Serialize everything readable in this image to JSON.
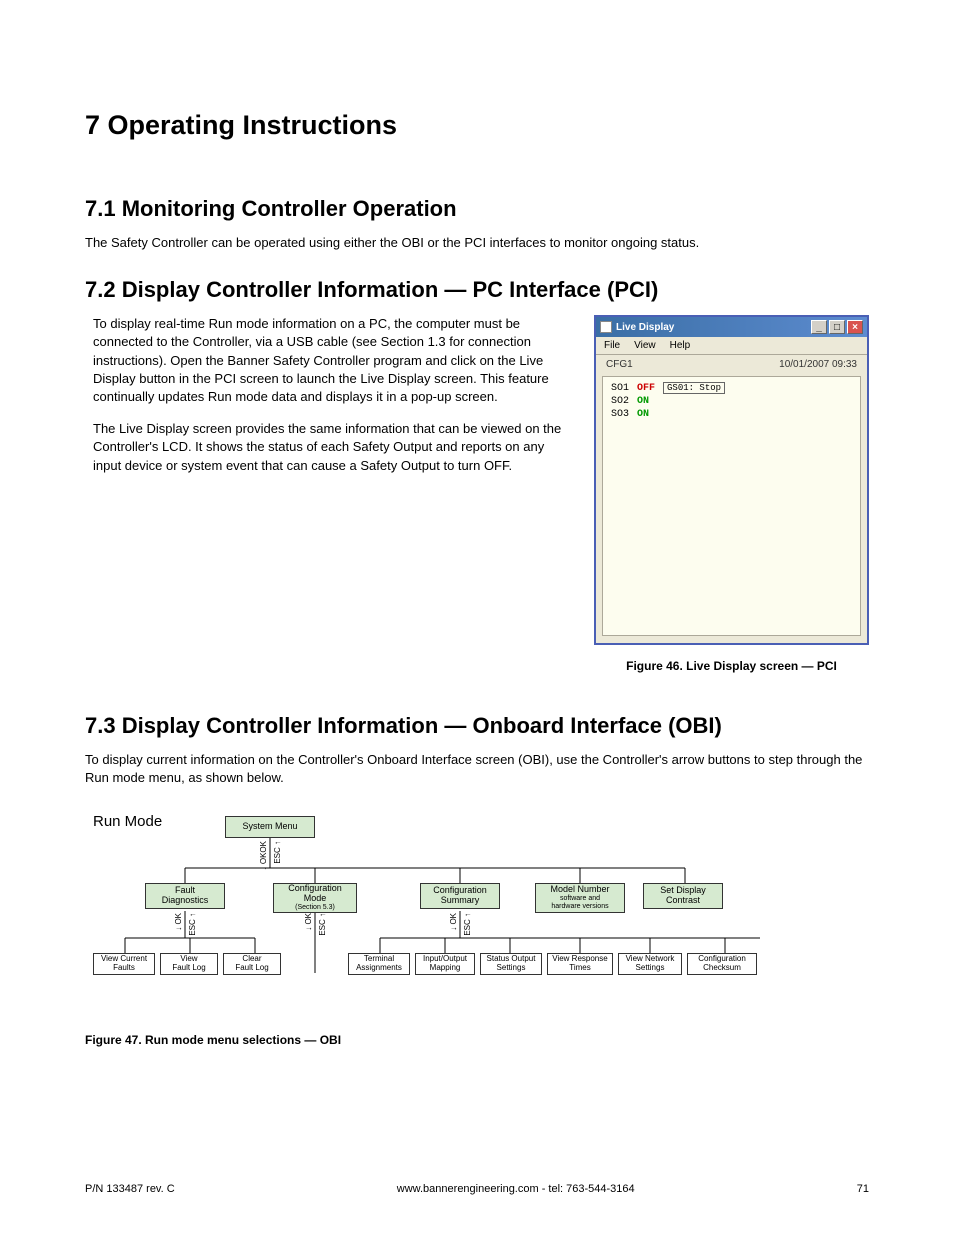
{
  "headings": {
    "h1": "7 Operating Instructions",
    "h2_1": "7.1 Monitoring Controller Operation",
    "h2_2": "7.2 Display Controller Information — PC Interface (PCI)",
    "h2_3": "7.3 Display Controller Information — Onboard Interface (OBI)"
  },
  "paragraphs": {
    "p71": "The Safety Controller can be operated using either the OBI or the PCI interfaces to monitor ongoing status.",
    "p72a": "To display real-time Run mode information on a PC, the computer must be connected to the Controller, via a USB cable (see Section 1.3 for connection instructions). Open the Banner Safety Controller program and click on the Live Display button in the PCI screen to launch the Live Display screen. This feature continually updates Run mode data and displays it in a pop-up screen.",
    "p72b": "The Live Display screen provides the same information that can be viewed on the Controller's LCD. It shows the status of each Safety Output and reports on any input device or system event that can cause a Safety Output to turn OFF.",
    "p73": "To display current information on the Controller's Onboard Interface screen (OBI), use the Controller's arrow buttons to step through the Run mode menu, as shown below."
  },
  "live_display": {
    "title": "Live Display",
    "menu": {
      "file": "File",
      "view": "View",
      "help": "Help"
    },
    "cfg": "CFG1",
    "timestamp": "10/01/2007 09:33",
    "rows": [
      {
        "id": "SO1",
        "state": "OFF",
        "tag": "GS01: Stop"
      },
      {
        "id": "SO2",
        "state": "ON",
        "tag": ""
      },
      {
        "id": "SO3",
        "state": "ON",
        "tag": ""
      }
    ],
    "caption": "Figure 46. Live Display screen — PCI"
  },
  "diagram": {
    "run_mode_label": "Run Mode",
    "system_menu": "System Menu",
    "row2": {
      "fault_diag": "Fault\nDiagnostics",
      "config_mode": "Configuration\nMode",
      "config_mode_sub": "(Section 5.3)",
      "config_summary": "Configuration\nSummary",
      "model_number": "Model Number",
      "model_number_sub": "software and\nhardware versions",
      "set_display": "Set Display\nContrast"
    },
    "row3": {
      "view_current": "View Current\nFaults",
      "view_log": "View\nFault Log",
      "clear_log": "Clear\nFault Log",
      "terminal": "Terminal\nAssignments",
      "io_map": "Input/Output\nMapping",
      "status_out": "Status Output\nSettings",
      "view_resp": "View Response\nTimes",
      "view_net": "View Network\nSettings",
      "config_chk": "Configuration\nChecksum"
    },
    "nav": {
      "ok": "OK",
      "esc": "ESC"
    },
    "caption": "Figure 47. Run mode menu selections — OBI"
  },
  "footer": {
    "left": "P/N 133487 rev. C",
    "center": "www.bannerengineering.com - tel: 763-544-3164",
    "right": "71"
  }
}
